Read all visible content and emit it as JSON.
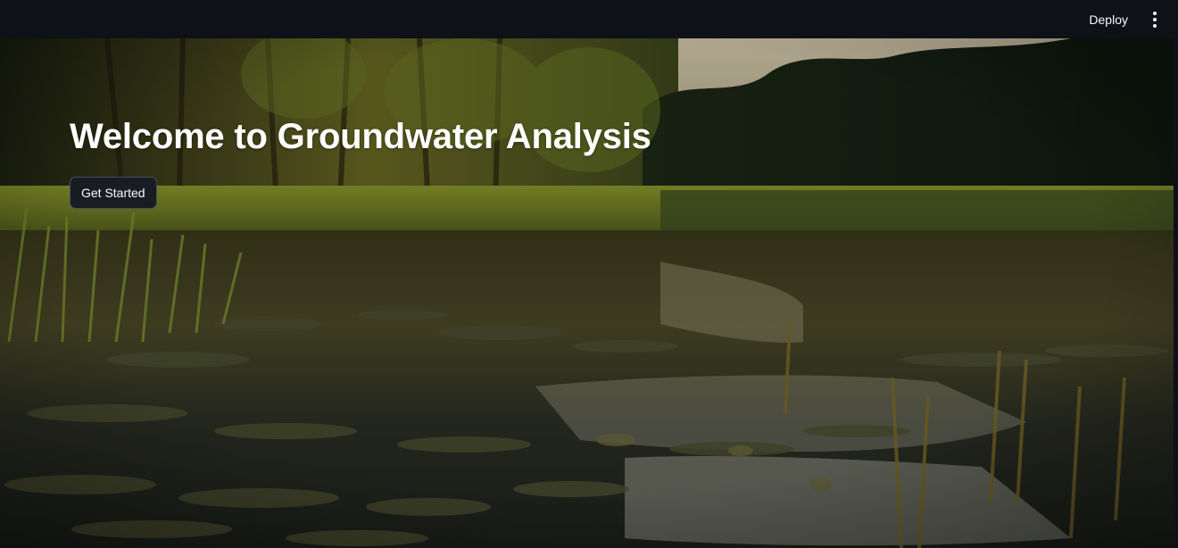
{
  "header": {
    "deploy_label": "Deploy",
    "menu_icon": "vertical-ellipsis-icon"
  },
  "hero": {
    "title": "Welcome to Groundwater Analysis",
    "cta_label": "Get Started",
    "background": "wetland-pond-photo"
  },
  "colors": {
    "header_bg": "#0e1117",
    "text": "#fafafa",
    "button_bg": "#1a1c24"
  }
}
